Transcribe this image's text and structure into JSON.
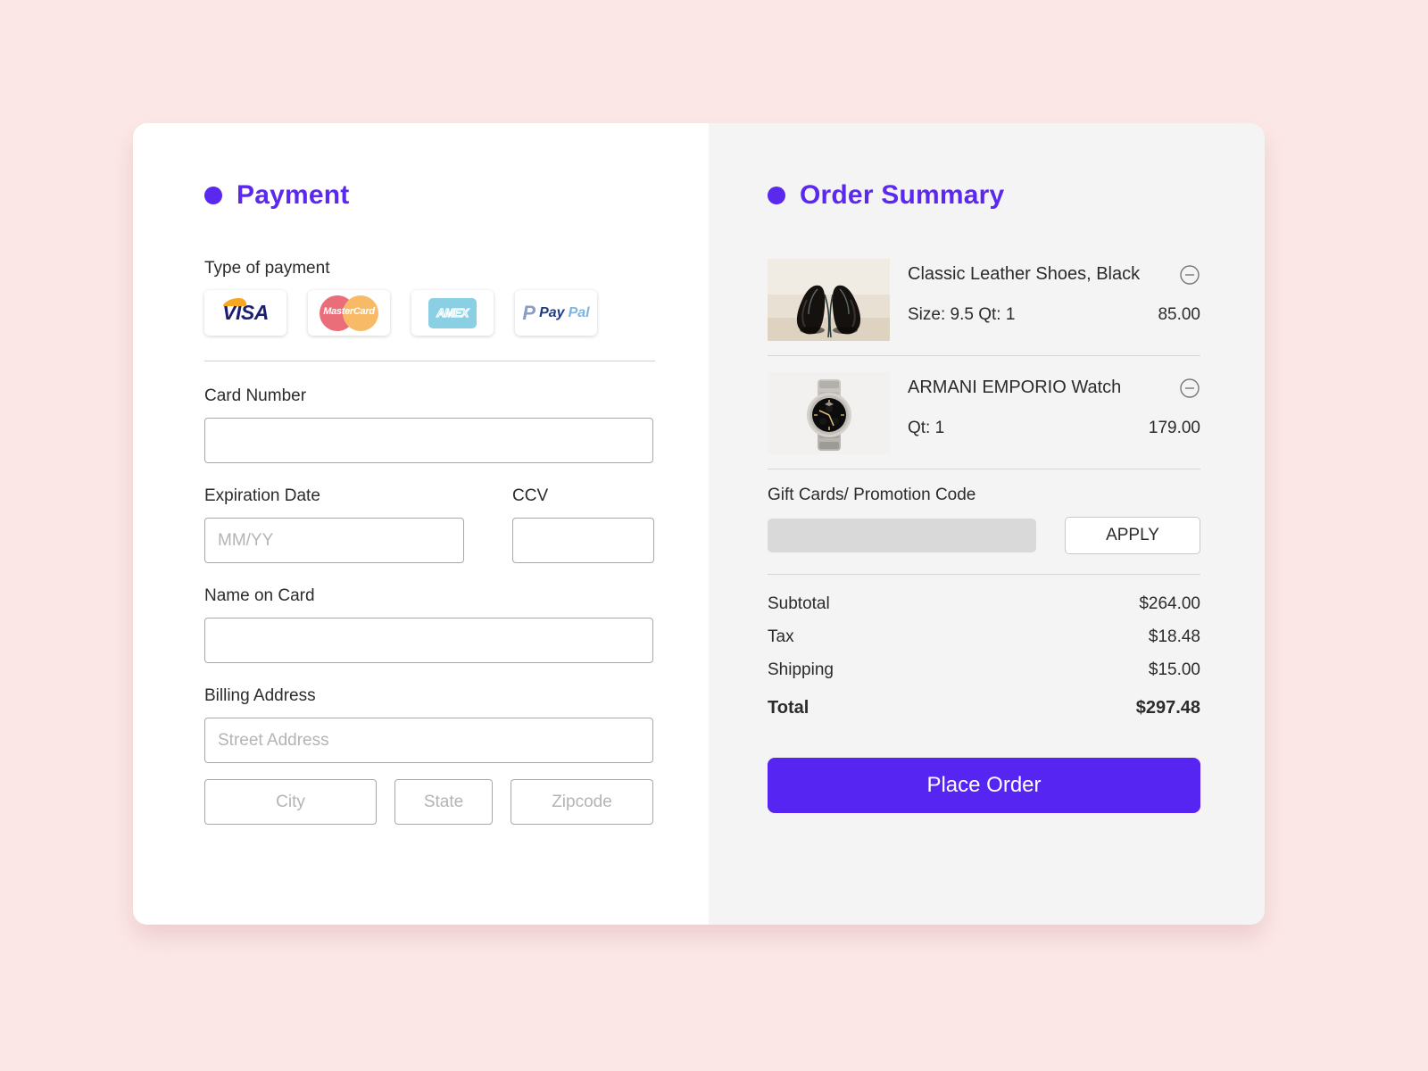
{
  "theme": {
    "page_background": "#fce7e7",
    "accent": "#5b28ee",
    "button": "#5625f2",
    "panel_left": "#ffffff",
    "panel_right": "#f4f4f4"
  },
  "payment": {
    "heading": "Payment",
    "type_label": "Type of payment",
    "methods": [
      {
        "name": "visa",
        "label": "VISA"
      },
      {
        "name": "mastercard",
        "label": "MasterCard"
      },
      {
        "name": "amex",
        "label": "AMEX"
      },
      {
        "name": "paypal",
        "label_dark": "Pay",
        "label_light": "Pal"
      }
    ],
    "card_number": {
      "label": "Card Number",
      "value": "",
      "placeholder": ""
    },
    "expiration": {
      "label": "Expiration Date",
      "value": "",
      "placeholder": "MM/YY"
    },
    "ccv": {
      "label": "CCV",
      "value": "",
      "placeholder": ""
    },
    "name_on_card": {
      "label": "Name on Card",
      "value": "",
      "placeholder": ""
    },
    "billing_address": {
      "label": "Billing Address",
      "street": {
        "value": "",
        "placeholder": "Street Address"
      },
      "city": {
        "value": "",
        "placeholder": "City"
      },
      "state": {
        "value": "",
        "placeholder": "State"
      },
      "zipcode": {
        "value": "",
        "placeholder": "Zipcode"
      }
    }
  },
  "order_summary": {
    "heading": "Order Summary",
    "items": [
      {
        "name": "Classic Leather Shoes, Black",
        "meta": "Size: 9.5  Qt: 1",
        "price": "85.00",
        "thumb": "black-leather-dress-shoes"
      },
      {
        "name": "ARMANI EMPORIO Watch",
        "meta": "Qt: 1",
        "price": "179.00",
        "thumb": "silver-chronograph-watch"
      }
    ],
    "promo": {
      "label": "Gift Cards/ Promotion Code",
      "value": "",
      "placeholder": "",
      "apply_label": "APPLY"
    },
    "totals": [
      {
        "label": "Subtotal",
        "value": "$264.00"
      },
      {
        "label": "Tax",
        "value": "$18.48"
      },
      {
        "label": "Shipping",
        "value": "$15.00"
      }
    ],
    "grand_total": {
      "label": "Total",
      "value": "$297.48"
    },
    "place_order_label": "Place Order"
  }
}
